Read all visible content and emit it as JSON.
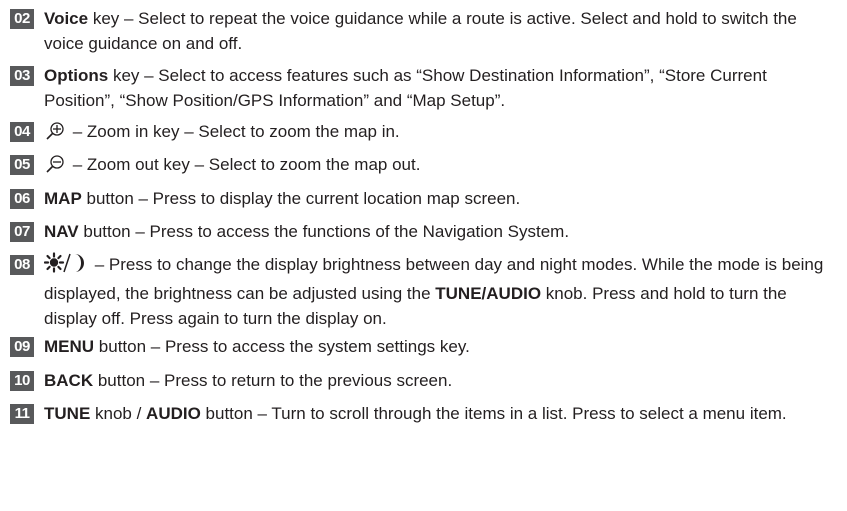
{
  "items": [
    {
      "num": "02",
      "key": "Voice",
      "text": " key – Select to repeat the voice guidance while a route is active. Select and hold to switch the voice guidance on and off."
    },
    {
      "num": "03",
      "key": "Options",
      "text": " key – Select to access features such as “Show Destination Information”, “Store Current Position”, “Show Position/GPS Information” and “Map Setup”."
    },
    {
      "num": "04",
      "icon": "zoom-in-icon",
      "text": " – Zoom in key – Select to zoom the map in."
    },
    {
      "num": "05",
      "icon": "zoom-out-icon",
      "text": " – Zoom out key – Select to zoom the map out."
    },
    {
      "num": "06",
      "key": "MAP",
      "text": " button – Press to display the current location map screen."
    },
    {
      "num": "07",
      "key": "NAV",
      "text": " button – Press to access the functions of the Navigation System."
    },
    {
      "num": "08",
      "icon": "day-night-icon",
      "text1": " – Press to change the display brightness between day and night modes. While the mode is being displayed, the brightness can be adjusted using the ",
      "key2": "TUNE/AUDIO",
      "text2": " knob. Press and hold to turn the display off. Press again to turn the display on."
    },
    {
      "num": "09",
      "key": "MENU",
      "text": " button – Press to access the system settings key."
    },
    {
      "num": "10",
      "key": "BACK",
      "text": " button – Press to return to the previous screen."
    },
    {
      "num": "11",
      "key": "TUNE",
      "text1": " knob / ",
      "key2": "AUDIO",
      "text2": " button – Turn to scroll through the items in a list. Press to select a menu item."
    }
  ]
}
